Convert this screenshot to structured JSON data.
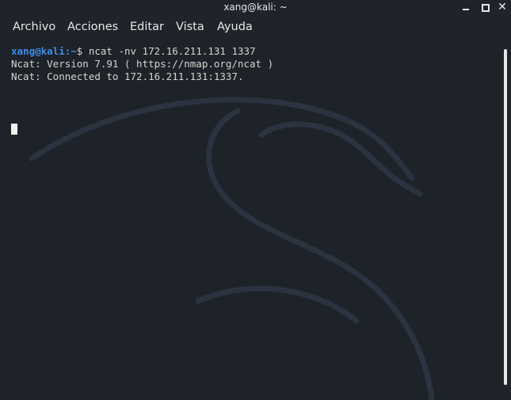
{
  "window": {
    "title": "xang@kali: ~",
    "controls": [
      "minimize-icon",
      "maximize-icon",
      "close-icon"
    ]
  },
  "menu": {
    "items": [
      "Archivo",
      "Acciones",
      "Editar",
      "Vista",
      "Ayuda"
    ]
  },
  "terminal": {
    "prompt_user_host": "xang@kali",
    "prompt_path": ":~",
    "prompt_symbol": "$ ",
    "command": "ncat -nv 172.16.211.131 1337",
    "output": [
      "Ncat: Version 7.91 ( https://nmap.org/ncat )",
      "Ncat: Connected to 172.16.211.131:1337."
    ]
  },
  "colors": {
    "background": "#1f232a",
    "prompt": "#3b8eea",
    "text": "#d3d7cf"
  }
}
